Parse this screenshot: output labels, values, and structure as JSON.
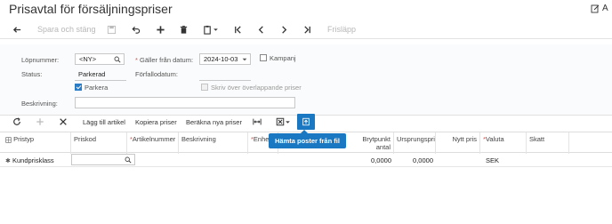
{
  "page": {
    "title": "Prisavtal för försäljningspriser",
    "notes_label": "A"
  },
  "toolbar": {
    "save_close": "Spara och stäng",
    "release": "Frisläpp"
  },
  "form": {
    "lopnummer_label": "Löpnummer:",
    "lopnummer_value": "<NY>",
    "status_label": "Status:",
    "status_value": "Parkerad",
    "parkera_label": "Parkera",
    "parkera_checked": true,
    "galler_label": "Gäller från datum:",
    "galler_value": "2024-10-03",
    "forfallo_label": "Förfallodatum:",
    "kampanj_label": "Kampanj",
    "skriv_over_label": "Skriv över överlappande priser",
    "beskrivning_label": "Beskrivning:",
    "beskrivning_value": ""
  },
  "grid_toolbar": {
    "add_article": "Lägg till artikel",
    "copy_prices": "Kopiera priser",
    "calc_new": "Beräkna nya priser",
    "tooltip": "Hämta poster från fil"
  },
  "grid": {
    "columns": [
      {
        "label": "Pristyp",
        "required": false
      },
      {
        "label": "Priskod",
        "required": false
      },
      {
        "label": "Artikelnummer",
        "required": true
      },
      {
        "label": "Beskrivning",
        "required": false
      },
      {
        "label": "Enhet",
        "required": true
      },
      {
        "label": "Brytpunkt antal",
        "required": false
      },
      {
        "label": "Ursprungspris",
        "required": false
      },
      {
        "label": "Nytt pris",
        "required": false
      },
      {
        "label": "Valuta",
        "required": true
      },
      {
        "label": "Skatt",
        "required": false
      }
    ],
    "rows": [
      {
        "pristyp": "Kundprisklass",
        "priskod": "",
        "artikelnummer": "",
        "beskrivning": "",
        "enhet": "",
        "brytpunkt": "0,0000",
        "ursprungspris": "0,0000",
        "nytt_pris": "",
        "valuta": "SEK",
        "skatt": ""
      }
    ]
  },
  "colors": {
    "accent": "#1a78c2",
    "required": "#d9534f"
  }
}
